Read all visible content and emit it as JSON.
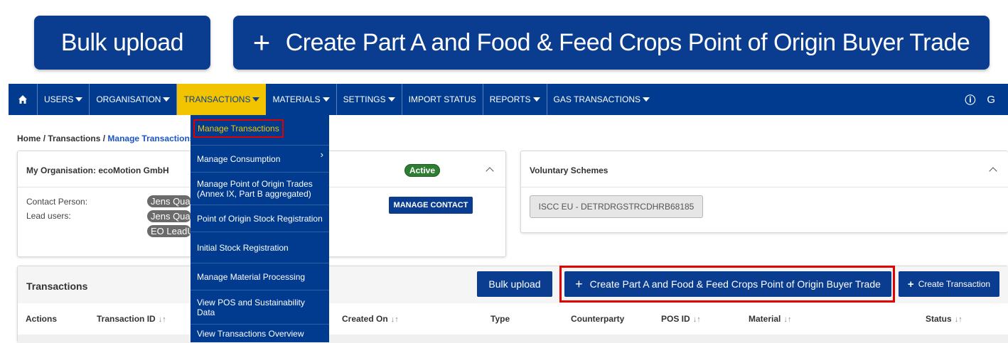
{
  "banner": {
    "bulk_upload": "Bulk upload",
    "create_plus": "+",
    "create_trade": "Create Part A and Food & Feed Crops Point of Origin Buyer Trade"
  },
  "nav": {
    "home_icon": "home-icon",
    "items": [
      "USERS",
      "ORGANISATION",
      "TRANSACTIONS",
      "MATERIALS",
      "SETTINGS",
      "IMPORT STATUS",
      "REPORTS",
      "GAS TRANSACTIONS"
    ],
    "info_icon": "ⓘ",
    "logout_icon": "G"
  },
  "breadcrumb": {
    "home": "Home",
    "transactions": "Transactions",
    "manage": "Manage Transactions"
  },
  "dropdown": {
    "items": [
      "Manage Transactions",
      "Manage Consumption",
      "Manage Point of Origin Trades (Annex IX, Part B aggregated)",
      "Point of Origin Stock Registration",
      "Initial Stock Registration",
      "Manage Material Processing",
      "View POS and Sustainability Data",
      "View Transactions Overview"
    ]
  },
  "organisation": {
    "title": "My Organisation: ecoMotion GmbH",
    "status": "Active",
    "contact_label": "Contact Person:",
    "lead_label": "Lead users:",
    "contact_value": "Jens Qua",
    "lead_value_1": "Jens Qua",
    "lead_value_2": "EO LeadU",
    "manage_contact": "MANAGE CONTACT"
  },
  "voluntary": {
    "title": "Voluntary Schemes",
    "scheme": "ISCC EU - DETRDRGSTRCDHRB68185"
  },
  "transactions": {
    "title": "Transactions",
    "bulk_upload": "Bulk upload",
    "create_trade": "Create Part A and Food & Feed Crops Point of Origin Buyer Trade",
    "create_transaction": "Create Transaction",
    "columns": [
      "Actions",
      "Transaction ID",
      "Created On",
      "Type",
      "Counterparty",
      "POS ID",
      "Material",
      "Status"
    ],
    "sort_icon": "↓↑"
  },
  "colors": {
    "primary": "#0a3d8f",
    "nav": "#003b8f",
    "active_menu": "#f2c400",
    "highlight": "#e00000",
    "status_active": "#2e7d32"
  }
}
